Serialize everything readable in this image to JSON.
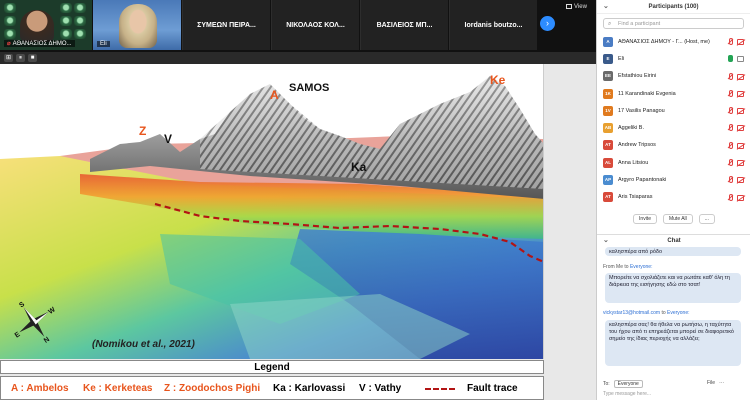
{
  "video_strip": {
    "gallery_name": "ΑΘΑΝΑΣΙΟΣ ΔΗΜΟ...",
    "eli_name": "Eli",
    "tiles": [
      "ΣΥΜΕΩΝ ΠΕΙΡΑ...",
      "ΝΙΚΟΛΑΟΣ ΚΟΛ...",
      "ΒΑΣΙΛΕΙΟΣ ΜΠ...",
      "Iordanis boutzo..."
    ],
    "next_icon": "›",
    "view_label": "View"
  },
  "share_controls": [
    "⊞",
    "⏸",
    "■"
  ],
  "slide": {
    "labels": {
      "samos": "SAMOS",
      "a": "A",
      "ke": "Ke",
      "z": "Z",
      "v": "V",
      "ka": "Ka"
    },
    "citation": "(Nomikou et al., 2021)",
    "compass": {
      "n": "N",
      "s": "S",
      "e": "E",
      "w": "W"
    },
    "legend_title": "Legend",
    "legend": {
      "a": "A : Ambelos",
      "ke": "Ke : Kerketeas",
      "z": "Z : Zoodochos Pighi",
      "ka": "Ka : Karlovassi",
      "v": "V : Vathy",
      "fault": "Fault trace"
    },
    "colors": {
      "label_orange": "#e8551d",
      "fault_red": "#b21414"
    }
  },
  "panel": {
    "title": "Participants (100)",
    "search_placeholder": "Find a participant",
    "participants": [
      {
        "initials": "A",
        "name": "ΑΘΑΝΑΣΙΟΣ ΔΗΜΟΥ - Γ... (Host, me)",
        "color": "#4a7cc4",
        "audio": "muted"
      },
      {
        "initials": "E",
        "name": "Eli",
        "color": "#3a5a8a",
        "audio": "on"
      },
      {
        "initials": "EE",
        "name": "Efstathiou Eirini",
        "color": "#6a6a6a",
        "audio": "muted"
      },
      {
        "initials": "1K",
        "name": "11 Karandinaki Evgenia",
        "color": "#e07a1e",
        "audio": "muted"
      },
      {
        "initials": "1V",
        "name": "17 Vasilis Panagou",
        "color": "#e07a1e",
        "audio": "muted"
      },
      {
        "initials": "AB",
        "name": "Aggeliki B.",
        "color": "#e8a030",
        "audio": "muted"
      },
      {
        "initials": "AT",
        "name": "Andrew Tripsos",
        "color": "#d84a3a",
        "audio": "muted"
      },
      {
        "initials": "AL",
        "name": "Anna Litsiou",
        "color": "#d84a3a",
        "audio": "muted"
      },
      {
        "initials": "AP",
        "name": "Argyro Papantonaki",
        "color": "#4a8cd0",
        "audio": "muted"
      },
      {
        "initials": "AT",
        "name": "Aris Tsiaparas",
        "color": "#d84a3a",
        "audio": "muted"
      }
    ],
    "invite_label": "Invite",
    "mute_all_label": "Mute All",
    "more_label": "...",
    "chat_title": "Chat",
    "chat": {
      "top_partial": "καλησπέρα από ρόδο",
      "from1_prefix": "From Me to",
      "from1_to": "Everyone:",
      "msg1": "Μπορείτε να σχολιάζετε και να ρωτάτε καθ' όλη τη διάρκεια της εισήγησης εδώ στο τσατ!",
      "from2_email": "vickystar13@hotmail.com",
      "from2_mid": "to",
      "from2_to": "Everyone:",
      "msg2": "καλησπέρα σας! θα ήθελα να ρωτήσω, η ταχύτητα του ήχου από τι επηρεάζεται μπορεί σε διαφορετικό σημείο της ίδιας περιοχής να αλλάζει;",
      "to_label": "To:",
      "to_value": "Everyone",
      "file_label": "File",
      "more": "···",
      "input_placeholder": "Type message here..."
    }
  }
}
